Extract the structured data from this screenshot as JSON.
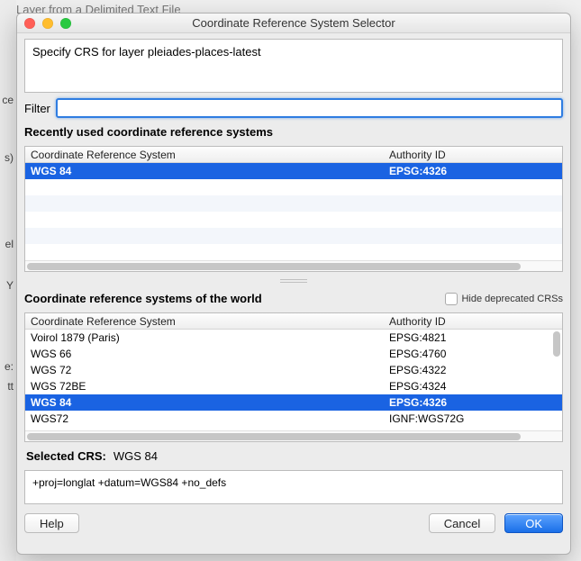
{
  "background": {
    "behind_text": "Layer from a Delimited Text File",
    "left_fragments": [
      "ce",
      "s)",
      "el",
      "Y",
      "e:",
      "tt"
    ]
  },
  "titlebar": {
    "title": "Coordinate Reference System Selector"
  },
  "specify": {
    "text": "Specify CRS for layer pleiades-places-latest"
  },
  "filter": {
    "label": "Filter",
    "value": ""
  },
  "recent": {
    "header": "Recently used coordinate reference systems",
    "columns": {
      "crs": "Coordinate Reference System",
      "auth": "Authority ID"
    },
    "rows": [
      {
        "crs": "WGS 84",
        "auth": "EPSG:4326",
        "selected": true
      }
    ],
    "blank_rows": 5
  },
  "world": {
    "header": "Coordinate reference systems of the world",
    "hide_deprecated_label": "Hide deprecated CRSs",
    "hide_deprecated_checked": false,
    "columns": {
      "crs": "Coordinate Reference System",
      "auth": "Authority ID"
    },
    "rows": [
      {
        "crs": "Voirol 1879 (Paris)",
        "auth": "EPSG:4821",
        "selected": false
      },
      {
        "crs": "WGS 66",
        "auth": "EPSG:4760",
        "selected": false
      },
      {
        "crs": "WGS 72",
        "auth": "EPSG:4322",
        "selected": false
      },
      {
        "crs": "WGS 72BE",
        "auth": "EPSG:4324",
        "selected": false
      },
      {
        "crs": "WGS 84",
        "auth": "EPSG:4326",
        "selected": true
      },
      {
        "crs": "WGS72",
        "auth": "IGNF:WGS72G",
        "selected": false
      }
    ]
  },
  "selected": {
    "label": "Selected CRS:",
    "value": "WGS 84"
  },
  "proj": {
    "text": "+proj=longlat +datum=WGS84 +no_defs"
  },
  "buttons": {
    "help": "Help",
    "cancel": "Cancel",
    "ok": "OK"
  }
}
